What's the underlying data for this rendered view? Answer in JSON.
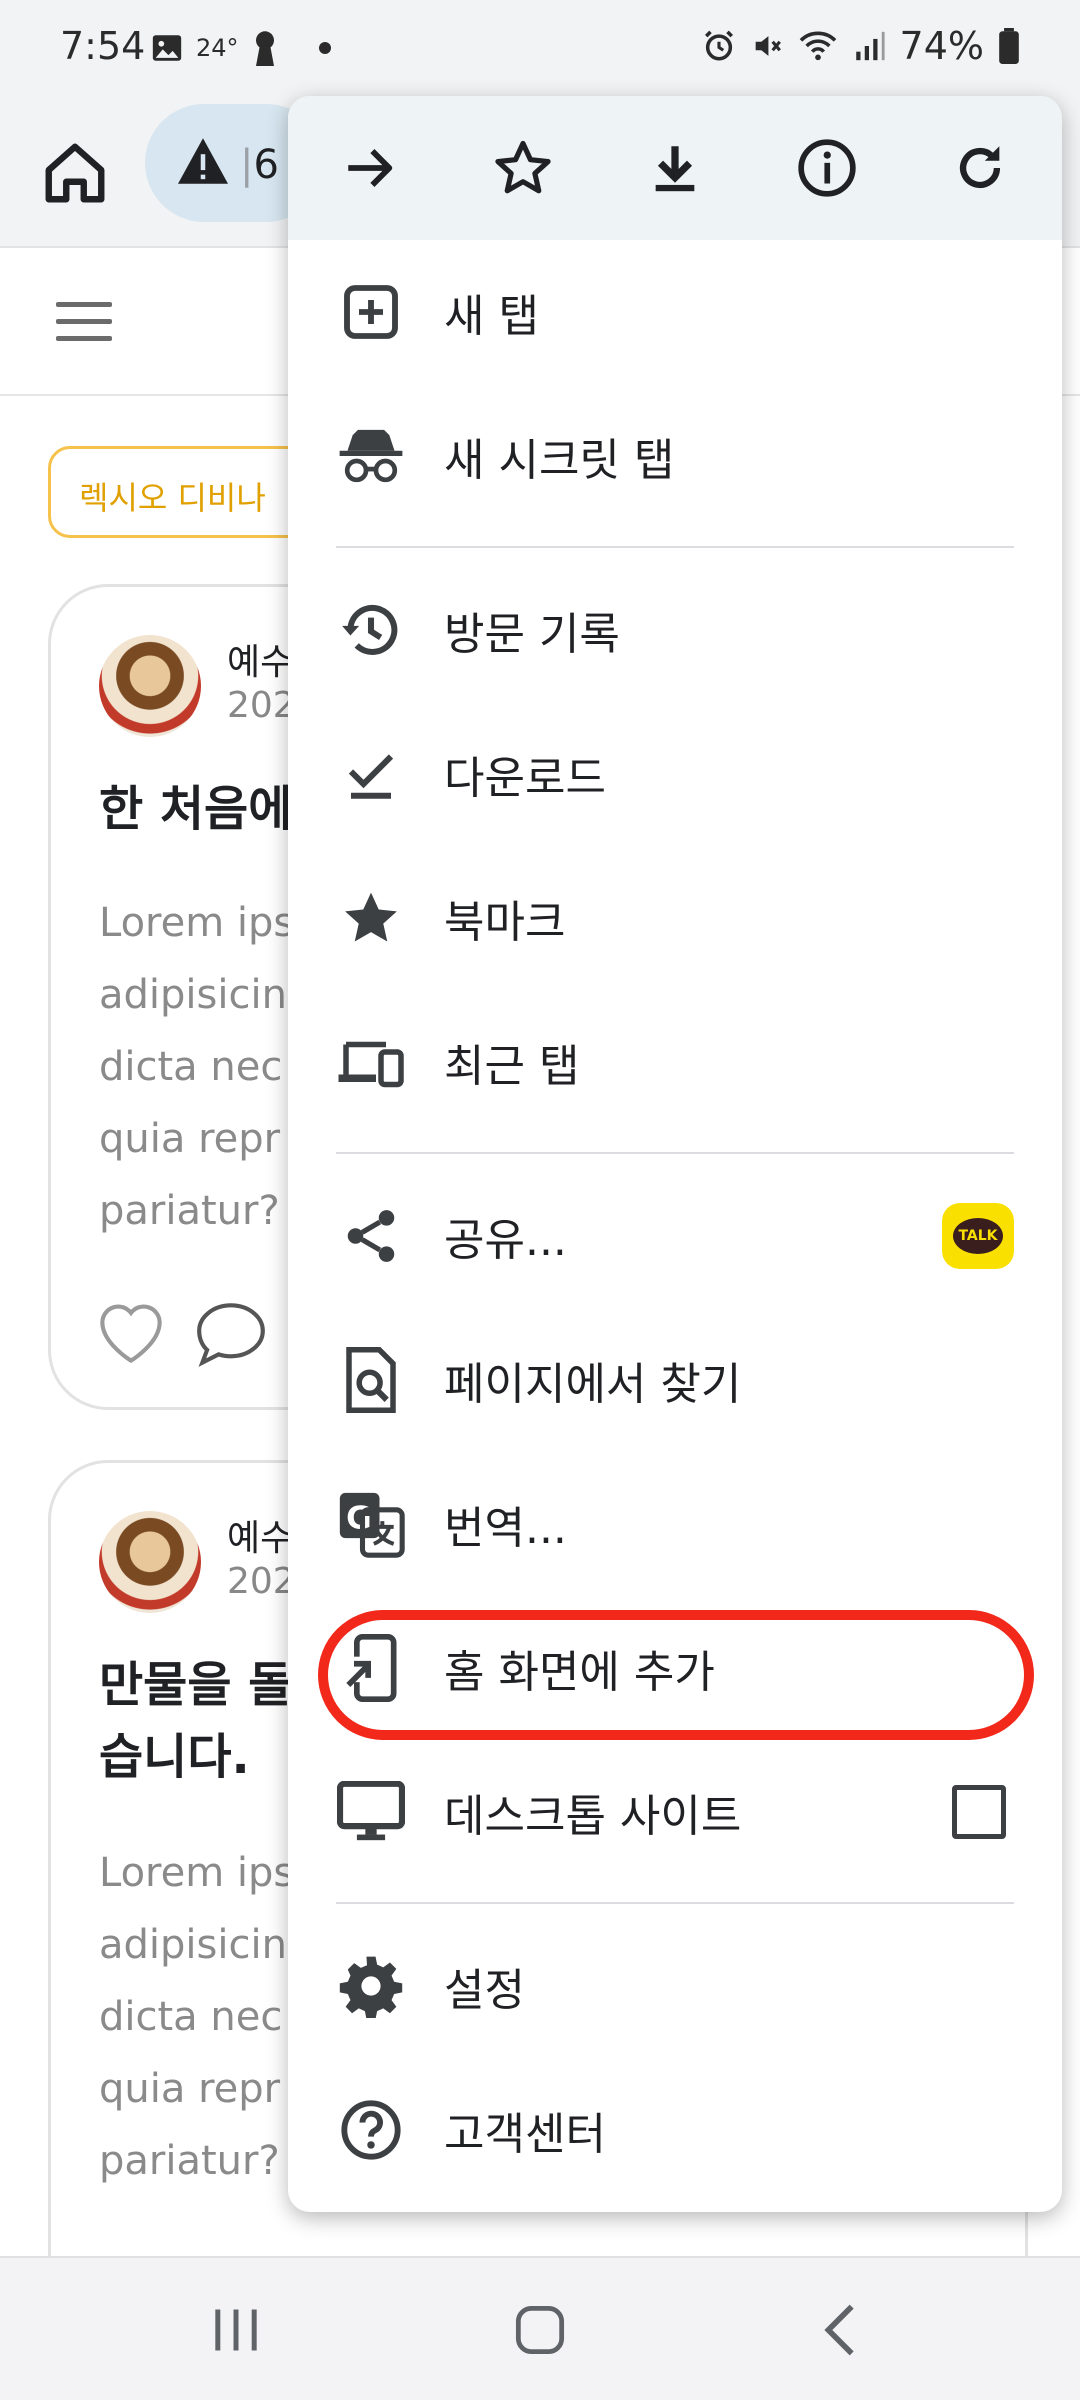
{
  "status_bar": {
    "time": "7:54",
    "temperature": "24°",
    "battery": "74%"
  },
  "toolbar": {
    "url_partial": "6"
  },
  "page": {
    "tag_chip": "렉시오 디비나",
    "posts": [
      {
        "author": "예수",
        "date": "202",
        "title": "한 처음에",
        "body": [
          "Lorem ips",
          "adipisicin",
          "dicta nec",
          "quia repr",
          "pariatur?"
        ]
      },
      {
        "author": "예수",
        "date": "202",
        "title_lines": [
          "만물을 돌",
          "습니다."
        ],
        "body": [
          "Lorem ips",
          "adipisicin",
          "dicta nec",
          "quia repr",
          "pariatur?"
        ]
      }
    ]
  },
  "menu": {
    "top_icons": [
      "forward-icon",
      "bookmark-star-icon",
      "download-icon",
      "info-icon",
      "refresh-icon"
    ],
    "items": [
      {
        "label": "새 탭",
        "icon": "new-tab-icon"
      },
      {
        "label": "새 시크릿 탭",
        "icon": "incognito-icon"
      },
      {
        "label": "방문 기록",
        "icon": "history-icon"
      },
      {
        "label": "다운로드",
        "icon": "downloads-icon"
      },
      {
        "label": "북마크",
        "icon": "bookmarks-star-icon"
      },
      {
        "label": "최근 탭",
        "icon": "recent-tabs-icon"
      },
      {
        "label": "공유...",
        "icon": "share-icon",
        "badge": "TALK"
      },
      {
        "label": "페이지에서 찾기",
        "icon": "find-in-page-icon"
      },
      {
        "label": "번역...",
        "icon": "translate-icon"
      },
      {
        "label": "홈 화면에 추가",
        "icon": "add-to-home-icon"
      },
      {
        "label": "데스크톱 사이트",
        "icon": "desktop-icon",
        "checked": false
      },
      {
        "label": "설정",
        "icon": "settings-gear-icon"
      },
      {
        "label": "고객센터",
        "icon": "help-icon"
      }
    ]
  },
  "colors": {
    "highlight": "#f2281b",
    "talk_badge": "#f9e000",
    "chip_accent": "#e0a000"
  }
}
